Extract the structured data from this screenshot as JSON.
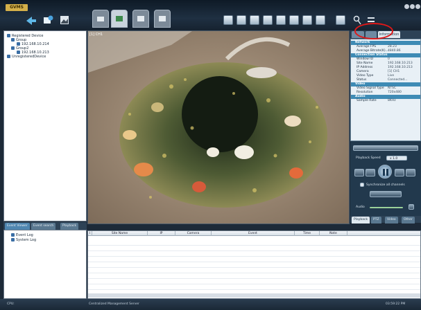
{
  "app": {
    "logo": "GVMS"
  },
  "tree": {
    "items": [
      {
        "label": "Registered Device",
        "level": 0
      },
      {
        "label": "Group",
        "level": 1
      },
      {
        "label": "192.168.10.214",
        "level": 2
      },
      {
        "label": "Group2",
        "level": 1
      },
      {
        "label": "192.168.10.213",
        "level": 2
      },
      {
        "label": "UnregisteredDevice",
        "level": 0
      }
    ]
  },
  "video": {
    "overlay_left": "[1] CH1"
  },
  "info_panel": {
    "tabs": [
      "",
      "Information"
    ],
    "sections": [
      {
        "header": "Network",
        "rows": [
          [
            "Average FPS",
            "28.23"
          ],
          [
            "Average Bitrate(K)...",
            "4840.86"
          ]
        ]
      },
      {
        "header": "Connection Status",
        "rows": [
          [
            "Window ID",
            "0"
          ],
          [
            "Site Name",
            "192.168.10.213"
          ],
          [
            "IP Address",
            "192.168.10.213"
          ],
          [
            "Camera",
            "[1] CH1"
          ],
          [
            "Video Type",
            "Live"
          ],
          [
            "Status",
            "Connected..."
          ]
        ]
      },
      {
        "header": "Video",
        "rows": [
          [
            "Video Signal Type",
            "NTSC"
          ],
          [
            "Resolution",
            "720x480"
          ]
        ]
      },
      {
        "header": "Audio",
        "rows": [
          [
            "Sample Rate",
            "8KHz"
          ]
        ]
      }
    ]
  },
  "controls": {
    "playback_speed_label": "Playback Speed",
    "playback_speed_value": "x 1.0",
    "sync_label": "Synchronize all channels",
    "audio_label": "Audio",
    "tabs": [
      "Playback",
      "PTZ",
      "Video",
      "Other"
    ]
  },
  "event_tabs": [
    "Event Viewer",
    "Event search",
    "Playback"
  ],
  "event_tree": [
    "Event Log",
    "System Log"
  ],
  "event_table": {
    "columns": [
      "I",
      "Site Name",
      "IP",
      "Camera",
      "Event",
      "Time",
      "Note"
    ]
  },
  "status": {
    "left": "CPU:",
    "center": "Centralized Management Server",
    "right": "03:59:22 PM"
  }
}
